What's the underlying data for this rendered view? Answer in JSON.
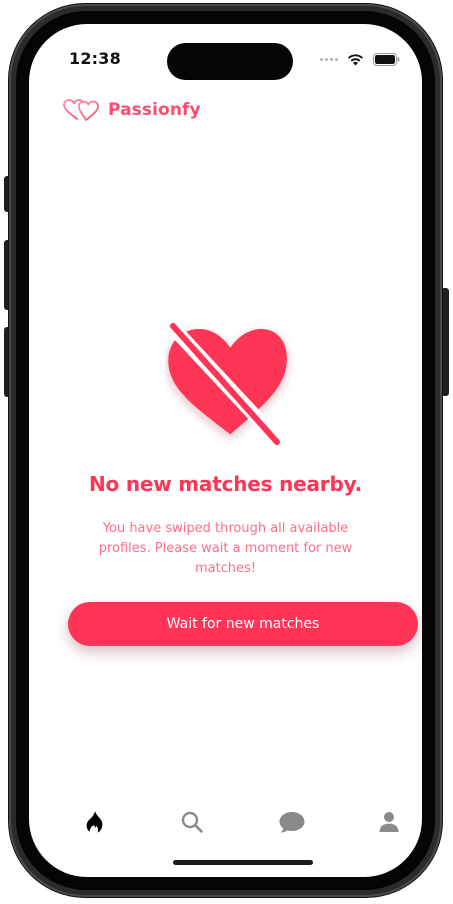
{
  "status_bar": {
    "time": "12:38"
  },
  "header": {
    "app_name": "Passionfy"
  },
  "empty_state": {
    "title": "No new matches nearby.",
    "subtitle": "You have swiped through all available profiles. Please wait a moment for new matches!",
    "button_label": "Wait for new matches"
  },
  "tabs": [
    {
      "icon": "flame-icon",
      "active": true
    },
    {
      "icon": "search-icon",
      "active": false
    },
    {
      "icon": "chat-bubble-icon",
      "active": false
    },
    {
      "icon": "profile-icon",
      "active": false
    }
  ],
  "colors": {
    "accent": "#ff3457",
    "brand": "#ff4d6d",
    "subtitle": "#ff6e88",
    "tab_active": "#000000",
    "tab_inactive": "#8a8a8a"
  }
}
